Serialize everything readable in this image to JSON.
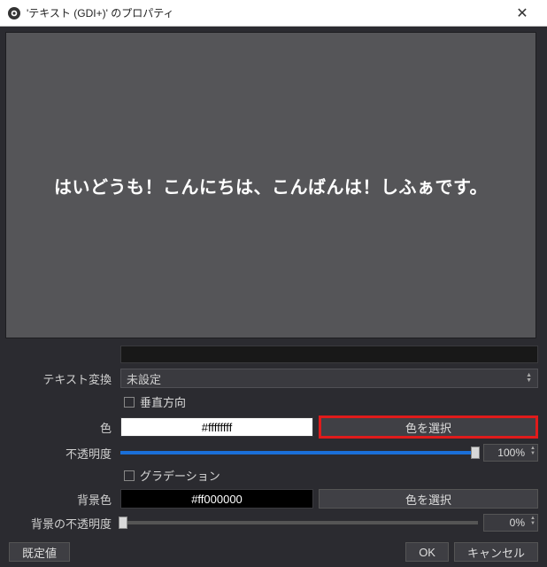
{
  "window": {
    "title": "'テキスト (GDI+)' のプロパティ"
  },
  "preview": {
    "text": "はいどうも！こんにちは、こんばんは！しふぁです。"
  },
  "fields": {
    "text_transform": {
      "label": "テキスト変換",
      "value": "未設定"
    },
    "vertical": {
      "label": "垂直方向"
    },
    "color": {
      "label": "色",
      "value": "#ffffffff",
      "choose": "色を選択"
    },
    "opacity": {
      "label": "不透明度",
      "value": "100%"
    },
    "gradient": {
      "label": "グラデーション"
    },
    "bg_color": {
      "label": "背景色",
      "value": "#ff000000",
      "choose": "色を選択"
    },
    "bg_opacity": {
      "label": "背景の不透明度",
      "value": "0%"
    }
  },
  "footer": {
    "defaults": "既定値",
    "ok": "OK",
    "cancel": "キャンセル"
  }
}
